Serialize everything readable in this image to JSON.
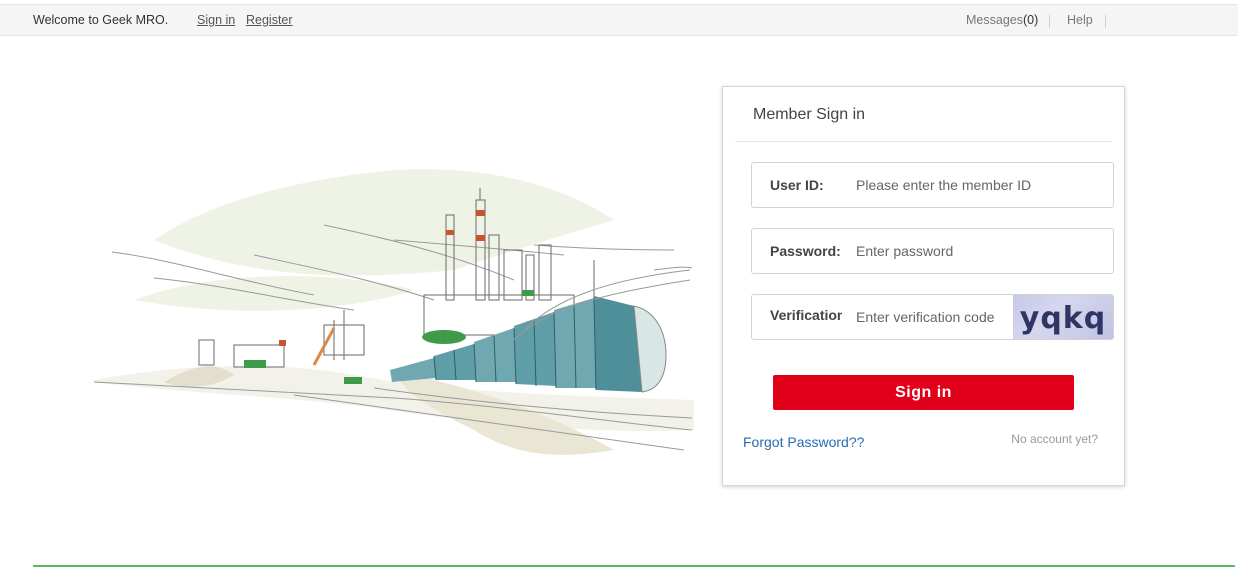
{
  "topbar": {
    "welcome": "Welcome to Geek MRO.",
    "sign_in": "Sign in",
    "register": "Register",
    "messages_label": "Messages",
    "messages_count": "(0)",
    "help": "Help"
  },
  "login": {
    "title": "Member Sign in",
    "user_label": "User ID:",
    "user_placeholder": "Please enter the member ID",
    "password_label": "Password:",
    "password_placeholder": "Enter password",
    "verification_label": "Verification:",
    "verification_placeholder": "Enter verification code",
    "captcha_text": "yqkq",
    "submit": "Sign in",
    "forgot": "Forgot Password??",
    "no_account": "No account yet?"
  },
  "colors": {
    "accent_red": "#e0001a",
    "link_blue": "#2a6ab4",
    "footer_green": "#5cb85c",
    "tank_teal": "#5f9ea7"
  },
  "icons": {
    "illustration": "industrial-refinery-pipeline-illustration"
  }
}
